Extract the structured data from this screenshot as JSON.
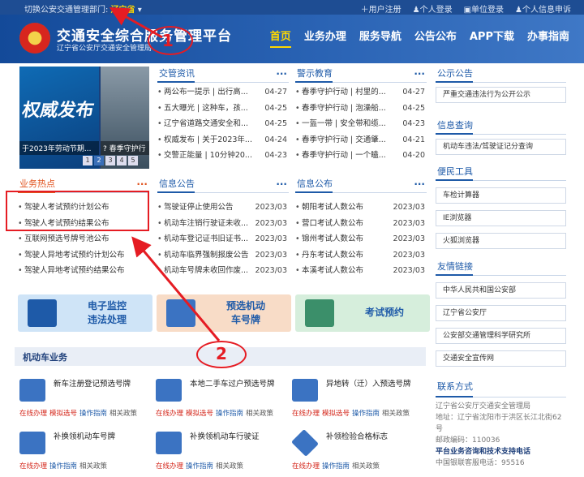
{
  "topbar": {
    "switch_label": "切换公安交通管理部门:",
    "province": "辽宁省",
    "links": [
      "用户注册",
      "个人登录",
      "单位登录",
      "个人信息申诉"
    ]
  },
  "header": {
    "title": "交通安全综合服务管理平台",
    "subtitle": "辽宁省公安厅交通安全管理局",
    "nav": [
      "首页",
      "业务办理",
      "服务导航",
      "公告公布",
      "APP下载",
      "办事指南"
    ]
  },
  "banner": {
    "big_text": "权威发布",
    "caption1": "于2023年劳动节期...",
    "caption2": "? 春季守护行",
    "dots": [
      "1",
      "2",
      "3",
      "4",
      "5"
    ]
  },
  "sections": {
    "jgzx": {
      "title": "交管资讯",
      "items": [
        {
          "text": "两公布一提示 | 出行高...",
          "date": "04-27"
        },
        {
          "text": "五大曝光 | 这种车，孩...",
          "date": "04-25"
        },
        {
          "text": "辽宁省道路交通安全和...",
          "date": "04-25"
        },
        {
          "text": "权威发布 | 关于2023年...",
          "date": "04-24"
        },
        {
          "text": "交警正能量 | 10分钟20...",
          "date": "04-23"
        }
      ]
    },
    "jsjy": {
      "title": "警示教育",
      "items": [
        {
          "text": "春季守护行动 | 村里的...",
          "date": "04-27"
        },
        {
          "text": "春季守护行动 | 泡澡船...",
          "date": "04-25"
        },
        {
          "text": "一盔一带 | 安全带和缆...",
          "date": "04-23"
        },
        {
          "text": "春季守护行动 | 交通肇...",
          "date": "04-21"
        },
        {
          "text": "春季守护行动 | 一个瞌...",
          "date": "04-20"
        }
      ]
    },
    "ywrd": {
      "title": "业务热点",
      "items": [
        "驾驶人考试预约计划公布",
        "驾驶人考试预约结果公布",
        "互联网预选号牌号池公布",
        "驾驶人异地考试预约计划公布",
        "驾驶人异地考试预约结果公布"
      ]
    },
    "xxgg": {
      "title": "信息公告",
      "items": [
        {
          "text": "驾驶证停止使用公告",
          "date": "2023/03"
        },
        {
          "text": "机动车注销行驶证未收...",
          "date": "2023/03"
        },
        {
          "text": "机动车登记证书旧证书...",
          "date": "2023/03"
        },
        {
          "text": "机动车临界强制报废公告",
          "date": "2023/03"
        },
        {
          "text": "机动车号牌未收回作废...",
          "date": "2023/03"
        }
      ]
    },
    "xxgb": {
      "title": "信息公布",
      "items": [
        {
          "text": "朝阳考试人数公布",
          "date": "2023/03"
        },
        {
          "text": "营口考试人数公布",
          "date": "2023/03"
        },
        {
          "text": "锦州考试人数公布",
          "date": "2023/03"
        },
        {
          "text": "丹东考试人数公布",
          "date": "2023/03"
        },
        {
          "text": "本溪考试人数公布",
          "date": "2023/03"
        }
      ]
    }
  },
  "services": [
    {
      "label1": "电子监控",
      "label2": "违法处理",
      "bg": "#cfe4f7",
      "color": "#1e5aa8"
    },
    {
      "label1": "预选机动",
      "label2": "车号牌",
      "bg": "#f8dcc7",
      "color": "#1e5aa8"
    },
    {
      "label1": "考试预约",
      "label2": "",
      "bg": "#d6eedc",
      "color": "#1e5aa8"
    }
  ],
  "business": {
    "title": "机动车业务",
    "items": [
      {
        "name": "新车注册登记预选号牌",
        "ops": [
          "在线办理",
          "模拟选号",
          "操作指南",
          "相关政策"
        ]
      },
      {
        "name": "本地二手车过户预选号牌",
        "ops": [
          "在线办理",
          "模拟选号",
          "操作指南",
          "相关政策"
        ]
      },
      {
        "name": "异地转（迁）入预选号牌",
        "ops": [
          "在线办理",
          "模拟选号",
          "操作指南",
          "相关政策"
        ]
      },
      {
        "name": "补换领机动车号牌",
        "ops": [
          "在线办理",
          "操作指南",
          "相关政策"
        ]
      },
      {
        "name": "补换领机动车行驶证",
        "ops": [
          "在线办理",
          "操作指南",
          "相关政策"
        ]
      },
      {
        "name": "补领检验合格标志",
        "ops": [
          "在线办理",
          "操作指南",
          "相关政策"
        ]
      }
    ]
  },
  "right": {
    "ggtb": {
      "title": "公示公告",
      "items": [
        "严重交通违法行为公开公示"
      ]
    },
    "xxcx": {
      "title": "信息查询",
      "items": [
        "机动车违法/驾驶证记分查询"
      ]
    },
    "bmgj": {
      "title": "便民工具",
      "items": [
        "车检计算器",
        "IE浏览器",
        "火狐浏览器"
      ]
    },
    "yqlj": {
      "title": "友情链接",
      "items": [
        "中华人民共和国公安部",
        "辽宁省公安厅",
        "公安部交通管理科学研究所",
        "交通安全宣传网"
      ]
    },
    "contact": {
      "title": "联系方式",
      "org": "辽宁省公安厅交通安全管理局",
      "address": "地址：辽宁省沈阳市于洪区长江北街62号",
      "postcode": "邮政编码：110036",
      "hotline": "平台业务咨询和技术支持电话",
      "phone": "中国银联客服电话：95516"
    }
  },
  "annotations": {
    "num1": "1",
    "num2": "2",
    "color": "#e51c23"
  }
}
